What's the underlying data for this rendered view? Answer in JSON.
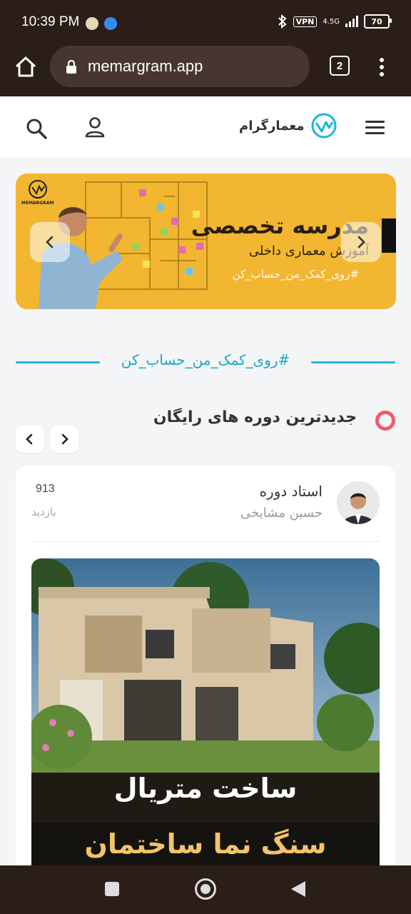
{
  "status": {
    "time": "10:39 PM",
    "network": "4.5G",
    "vpn": "VPN",
    "battery": "70"
  },
  "browser": {
    "url": "memargram.app",
    "tab_count": "2"
  },
  "site": {
    "brand": "معمارگرام"
  },
  "banner": {
    "logo_text": "MEMARGRAM",
    "title": "مدرسه تخصصی",
    "subtitle": "آموزش معماری داخلی",
    "hashtag": "#روی_کمک_من_حساب_کن"
  },
  "hashtag_divider": "#روی_کمک_من_حساب_کن",
  "section": {
    "title": "جدیدترین دوره های رایگان"
  },
  "course": {
    "teacher_label": "استاد دوره",
    "teacher_name": "حسین مشایخی",
    "views": "913",
    "views_label": "بازدید",
    "image_caption_1": "ساخت متریال",
    "image_caption_2": "سنگ نما ساختمان"
  },
  "colors": {
    "accent": "#1bb8d6",
    "bullet": "#f35a6a",
    "banner_bg": "#f2b630",
    "chrome_bg": "#2b1e19"
  }
}
